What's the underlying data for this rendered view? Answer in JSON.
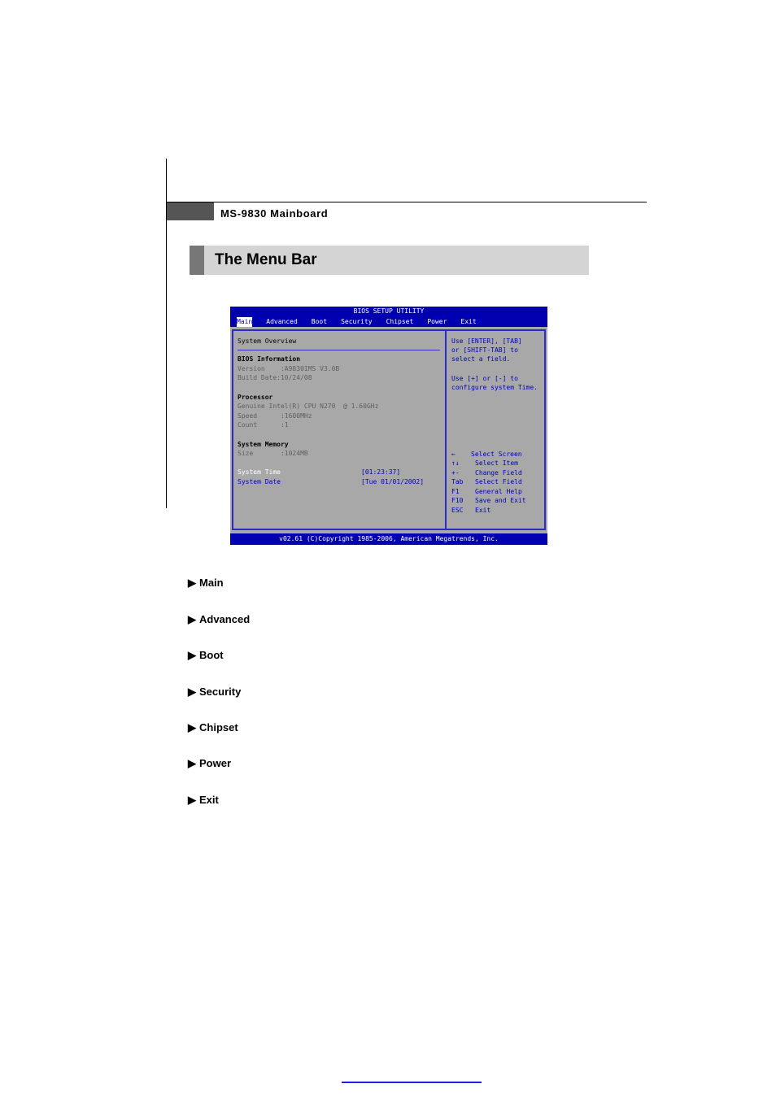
{
  "header": {
    "text": "MS-9830 Mainboard"
  },
  "section": {
    "title": "The Menu Bar"
  },
  "bios": {
    "title": "BIOS SETUP UTILITY",
    "tabs": [
      "Main",
      "Advanced",
      "Boot",
      "Security",
      "Chipset",
      "Power",
      "Exit"
    ],
    "active_tab": "Main",
    "overview": "System Overview",
    "bios_info_title": "BIOS Information",
    "version": "Version    :A9830IMS V3.0B",
    "build_date": "Build Date:10/24/08",
    "processor_title": "Processor",
    "processor_name": "Genuine Intel(R) CPU N270  @ 1.60GHz",
    "speed": "Speed      :1600MHz",
    "count": "Count      :1",
    "memory_title": "System Memory",
    "memory_size": "Size       :1024MB",
    "time_label": "System Time",
    "time_value": "[01:23:37]",
    "date_label": "System Date",
    "date_value": "[Tue 01/01/2002]",
    "help_1": "Use [ENTER], [TAB]",
    "help_2": "or [SHIFT-TAB] to",
    "help_3": "select a field.",
    "help_4": "Use [+] or [-] to",
    "help_5": "configure system Time.",
    "keys": [
      {
        "key": "←",
        "desc": "Select Screen"
      },
      {
        "key": "↑↓",
        "desc": "Select Item"
      },
      {
        "key": "+-",
        "desc": "Change Field"
      },
      {
        "key": "Tab",
        "desc": "Select Field"
      },
      {
        "key": "F1",
        "desc": "General Help"
      },
      {
        "key": "F10",
        "desc": "Save and Exit"
      },
      {
        "key": "ESC",
        "desc": "Exit"
      }
    ],
    "copyright": "v02.61 (C)Copyright 1985-2006, American Megatrends, Inc."
  },
  "menu": {
    "items": [
      "Main",
      "Advanced",
      "Boot",
      "Security",
      "Chipset",
      "Power",
      "Exit"
    ],
    "arrow": "▶"
  }
}
